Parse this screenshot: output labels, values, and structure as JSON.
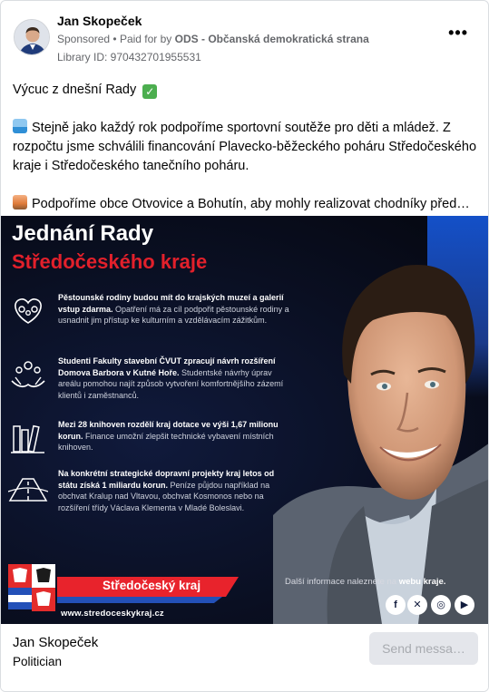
{
  "post": {
    "author": "Jan Skopeček",
    "sponsored": "Sponsored",
    "paid_prefix": "Paid for by",
    "payer": "ODS - Občanská demokratická strana",
    "library_id": "Library ID: 970432701955531",
    "more_icon": "more-options-icon",
    "text": {
      "line1": "Výcuc z dnešní Rady",
      "line2": "Stejně jako každý rok podpoříme sportovní soutěže pro děti a mládež. Z rozpočtu jsme schválili financování Plavecko-běžeckého poháru Středočeského kraje i Středočeského tanečního poháru.",
      "line3": "Podpoříme obce Otvovice a Bohutín, aby mohly realizovat chodníky před…"
    }
  },
  "banner": {
    "title_line1": "Jednání Rady",
    "title_line2": "Středočeského kraje",
    "items": [
      {
        "icon": "family-heart-icon",
        "bold": "Pěstounské rodiny budou mít do krajských muzeí a galerií vstup zdarma.",
        "rest": " Opatření má za cíl podpořit pěstounské rodiny a usnadnit jim přístup ke kulturním a vzdělávacím zážitkům."
      },
      {
        "icon": "helping-hands-icon",
        "bold": "Studenti Fakulty stavební ČVUT zpracují návrh rozšíření Domova Barbora v Kutné Hoře.",
        "rest": " Studentské návrhy úprav areálu pomohou najít způsob vytvoření komfortnějšího zázemí klientů i zaměstnanců."
      },
      {
        "icon": "books-icon",
        "bold": "Mezi 28 knihoven rozdělí kraj dotace ve výši 1,67 milionu korun.",
        "rest": " Finance umožní zlepšit technické vybavení místních knihoven."
      },
      {
        "icon": "road-icon",
        "bold": "Na konkrétní strategické dopravní projekty kraj letos od státu získá 1 miliardu korun.",
        "rest": " Peníze půjdou například na obchvat Kralup nad Vltavou, obchvat Kosmonos nebo na rozšíření třídy Václava Klementa v Mladé Boleslavi."
      }
    ],
    "region_name": "Středočeský kraj",
    "region_url": "www.stredoceskykraj.cz",
    "more_info_prefix": "Další informace naleznete na",
    "more_info_link": "webu kraje.",
    "social": [
      {
        "icon": "facebook-icon",
        "glyph": "f"
      },
      {
        "icon": "x-icon",
        "glyph": "✕"
      },
      {
        "icon": "instagram-icon",
        "glyph": "◎"
      },
      {
        "icon": "youtube-icon",
        "glyph": "▶"
      }
    ]
  },
  "footer": {
    "name": "Jan Skopeček",
    "category": "Politician",
    "button": "Send messa…"
  },
  "colors": {
    "accent_red": "#e2202b",
    "navy": "#0a0f22",
    "brand_blue": "#2350b8",
    "meta_gray": "#65676b"
  }
}
